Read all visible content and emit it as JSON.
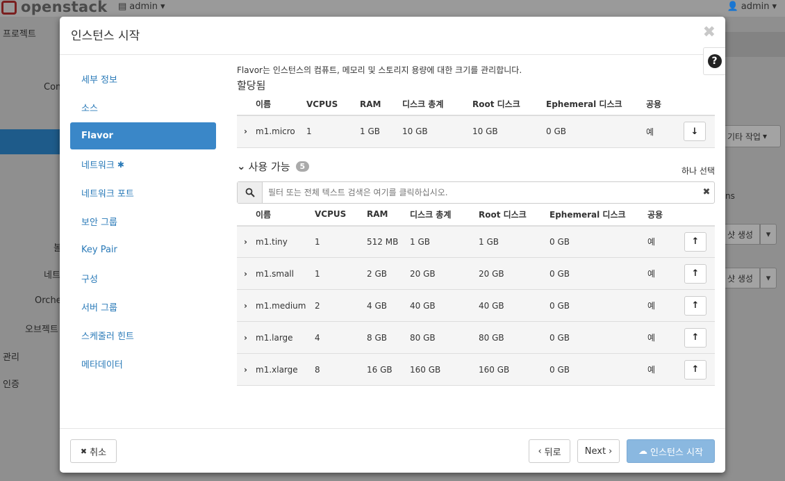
{
  "topbar": {
    "logo_text": "openstack",
    "project_label": "admin",
    "user_label": "admin"
  },
  "bg_sidebar": {
    "items": [
      "프로젝트",
      "Com",
      "볼",
      "네트",
      "Orche",
      "오브젝트",
      "관리",
      "인증"
    ]
  },
  "bg_right": {
    "other_actions": "기타 작업",
    "ns_text": "ns",
    "snapshot1": "샷 생성",
    "snapshot2": "샷 생성"
  },
  "modal": {
    "title": "인스턴스 시작",
    "close_icon": "close-icon",
    "help_icon": "question-icon"
  },
  "wizard": {
    "items": [
      {
        "label": "세부 정보"
      },
      {
        "label": "소스"
      },
      {
        "label": "Flavor"
      },
      {
        "label": "네트워크",
        "required_mark": "✱"
      },
      {
        "label": "네트워크 포트"
      },
      {
        "label": "보안 그룹"
      },
      {
        "label": "Key Pair"
      },
      {
        "label": "구성"
      },
      {
        "label": "서버 그룹"
      },
      {
        "label": "스케줄러 힌트"
      },
      {
        "label": "메타데이터"
      }
    ],
    "active_index": 2
  },
  "content": {
    "help_text": "Flavor는 인스턴스의 컴퓨트, 메모리 및 스토리지 용량에 대한 크기를 관리합니다.",
    "allocated_title": "할당됨",
    "columns": [
      "이름",
      "VCPUS",
      "RAM",
      "디스크 총계",
      "Root 디스크",
      "Ephemeral 디스크",
      "공용"
    ],
    "allocated": [
      {
        "name": "m1.micro",
        "vcpus": "1",
        "ram": "1 GB",
        "disk_total": "10 GB",
        "root_disk": "10 GB",
        "ephemeral": "0 GB",
        "public": "예"
      }
    ],
    "available_title": "사용 가능",
    "available_count": "5",
    "select_one": "하나 선택",
    "search_placeholder": "필터 또는 전체 텍스트 검색은 여기를 클릭하십시오.",
    "available": [
      {
        "name": "m1.tiny",
        "vcpus": "1",
        "ram": "512 MB",
        "disk_total": "1 GB",
        "root_disk": "1 GB",
        "ephemeral": "0 GB",
        "public": "예"
      },
      {
        "name": "m1.small",
        "vcpus": "1",
        "ram": "2 GB",
        "disk_total": "20 GB",
        "root_disk": "20 GB",
        "ephemeral": "0 GB",
        "public": "예"
      },
      {
        "name": "m1.medium",
        "vcpus": "2",
        "ram": "4 GB",
        "disk_total": "40 GB",
        "root_disk": "40 GB",
        "ephemeral": "0 GB",
        "public": "예"
      },
      {
        "name": "m1.large",
        "vcpus": "4",
        "ram": "8 GB",
        "disk_total": "80 GB",
        "root_disk": "80 GB",
        "ephemeral": "0 GB",
        "public": "예"
      },
      {
        "name": "m1.xlarge",
        "vcpus": "8",
        "ram": "16 GB",
        "disk_total": "160 GB",
        "root_disk": "160 GB",
        "ephemeral": "0 GB",
        "public": "예"
      }
    ]
  },
  "footer": {
    "cancel_label": "취소",
    "back_label": "뒤로",
    "next_label": "Next",
    "launch_label": "인스턴스 시작"
  },
  "colors": {
    "accent": "#3a87c8",
    "link": "#2a7ab8",
    "primary_disabled": "#8ab8e0"
  }
}
